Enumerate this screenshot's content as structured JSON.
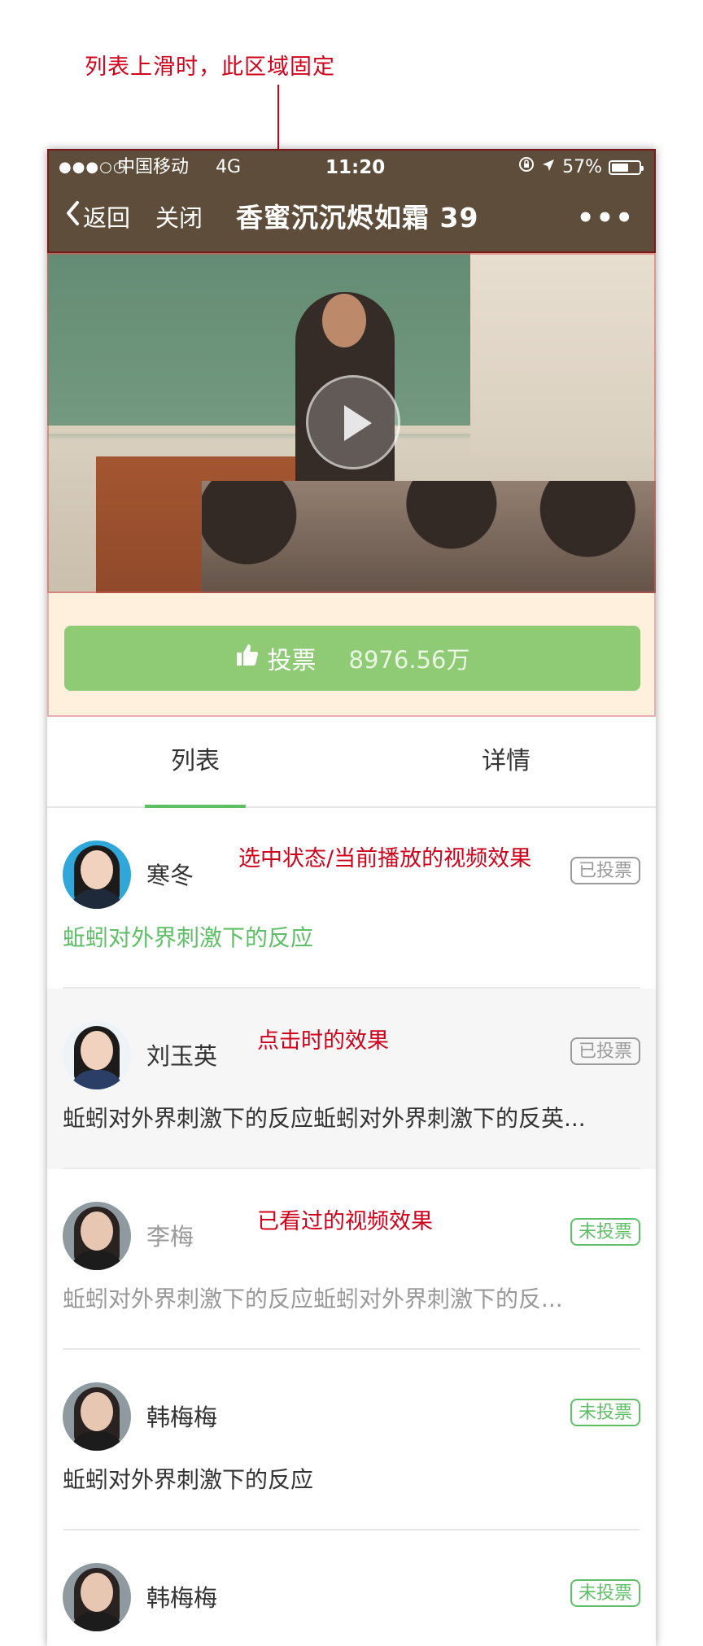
{
  "annotations": {
    "top_note": "列表上滑时，此区域固定",
    "item_selected": "选中状态/当前播放的视频效果",
    "item_pressed": "点击时的效果",
    "item_watched": "已看过的视频效果"
  },
  "status_bar": {
    "signal": "●●●○○",
    "carrier": "中国移动",
    "network": "4G",
    "time": "11:20",
    "battery": "57%"
  },
  "nav": {
    "back": "返回",
    "close": "关闭",
    "title": "香蜜沉沉烬如霜 39",
    "more": "•••"
  },
  "vote": {
    "label": "投票",
    "amount": "8976.56万"
  },
  "tabs": [
    "列表",
    "详情"
  ],
  "list": [
    {
      "name": "寒冬",
      "desc": "蚯蚓对外界刺激下的反应",
      "badge": "已投票",
      "state": "selected"
    },
    {
      "name": "刘玉英",
      "desc": "蚯蚓对外界刺激下的反应蚯蚓对外界刺激下的反英...",
      "badge": "已投票",
      "state": "pressed"
    },
    {
      "name": "李梅",
      "desc": "蚯蚓对外界刺激下的反应蚯蚓对外界刺激下的反...",
      "badge": "未投票",
      "state": "watched"
    },
    {
      "name": "韩梅梅",
      "desc": "蚯蚓对外界刺激下的反应",
      "badge": "未投票",
      "state": "normal"
    },
    {
      "name": "韩梅梅",
      "desc": "",
      "badge": "未投票",
      "state": "normal"
    }
  ],
  "colors": {
    "header_bg": "#5e4d3a",
    "accent_green": "#5fbf67",
    "vote_green": "#8fcb75",
    "annotation_red": "#d0021b",
    "vote_area_bg": "#fef0dd"
  }
}
